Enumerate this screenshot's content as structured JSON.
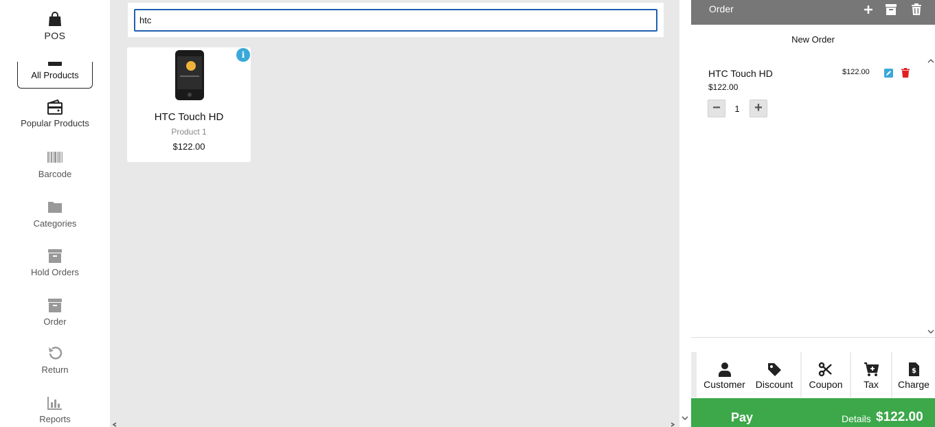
{
  "sidebar": {
    "items": [
      {
        "label": "POS",
        "icon": "shopping-bag-icon"
      },
      {
        "label": "All Products",
        "icon": "all-products-icon"
      },
      {
        "label": "Popular Products",
        "icon": "wallet-icon"
      },
      {
        "label": "Barcode",
        "icon": "barcode-icon"
      },
      {
        "label": "Categories",
        "icon": "folder-icon"
      },
      {
        "label": "Hold Orders",
        "icon": "archive-icon"
      },
      {
        "label": "Order",
        "icon": "archive-icon"
      },
      {
        "label": "Return",
        "icon": "undo-icon"
      },
      {
        "label": "Reports",
        "icon": "bar-chart-icon"
      }
    ]
  },
  "search": {
    "value": "htc"
  },
  "products": [
    {
      "name": "HTC Touch HD",
      "subtitle": "Product 1",
      "price": "$122.00"
    }
  ],
  "order": {
    "header_title": "Order",
    "new_order_label": "New Order",
    "lines": [
      {
        "name": "HTC Touch HD",
        "unit_price": "$122.00",
        "total": "$122.00",
        "quantity": "1"
      }
    ],
    "actions": [
      {
        "label": "Customer",
        "icon": "user-icon"
      },
      {
        "label": "Discount",
        "icon": "tag-icon"
      },
      {
        "label": "Coupon",
        "icon": "scissors-icon"
      },
      {
        "label": "Tax",
        "icon": "cart-plus-icon"
      },
      {
        "label": "Charge",
        "icon": "invoice-icon"
      }
    ],
    "pay_label": "Pay",
    "details_label": "Details",
    "total": "$122.00"
  },
  "colors": {
    "accent_blue": "#1f5fb0",
    "info_blue": "#3aa8d8",
    "pay_green": "#3ca84a",
    "header_gray": "#777777",
    "delete_red": "#e02020"
  }
}
